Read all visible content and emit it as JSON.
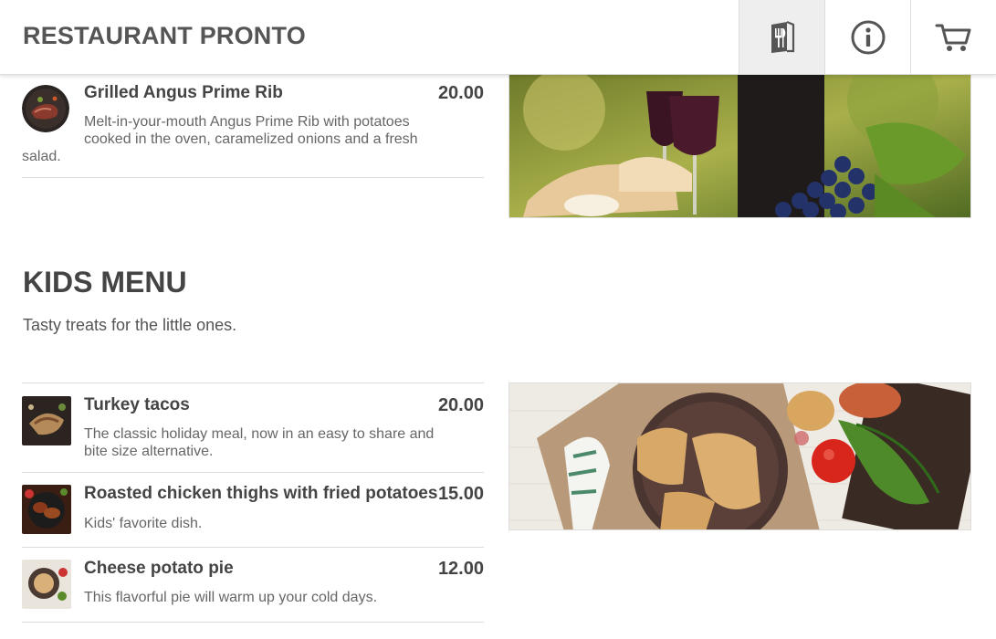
{
  "header": {
    "title": "RESTAURANT PRONTO",
    "nav": [
      {
        "icon": "menu-book-icon",
        "active": true
      },
      {
        "icon": "info-icon",
        "active": false
      },
      {
        "icon": "cart-icon",
        "active": false
      }
    ]
  },
  "main_section": {
    "items": [
      {
        "name": "Grilled Angus Prime Rib",
        "price": "20.00",
        "description_line1": "Melt-in-your-mouth Angus Prime Rib with potatoes",
        "description_line2": "cooked in the oven, caramelized onions and a fresh",
        "description_line3": "salad."
      }
    ]
  },
  "kids_menu": {
    "title": "KIDS MENU",
    "subtitle": "Tasty treats for the little ones.",
    "items": [
      {
        "name": "Turkey tacos",
        "price": "20.00",
        "description_line1": "The classic holiday meal, now in an easy to share and",
        "description_line2": "bite size alternative."
      },
      {
        "name": "Roasted chicken thighs with fried potatoes",
        "price": "15.00",
        "description": "Kids' favorite dish."
      },
      {
        "name": "Cheese potato pie",
        "price": "12.00",
        "description": "This flavorful pie will warm up your cold days."
      }
    ]
  }
}
